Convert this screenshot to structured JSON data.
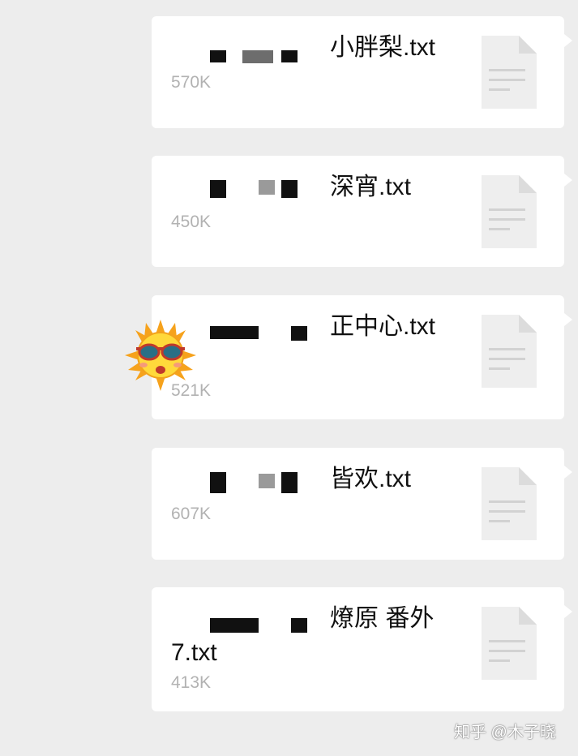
{
  "files": [
    {
      "name": "小胖梨.txt",
      "size": "570K"
    },
    {
      "name": "深宵.txt",
      "size": "450K"
    },
    {
      "name": "正中心.txt",
      "size": "521K"
    },
    {
      "name": "皆欢.txt",
      "size": "607K"
    },
    {
      "name": "燎原 番外7.txt",
      "size": "413K"
    }
  ],
  "watermark": "知乎 @木子晓",
  "icons": {
    "file": "document-icon",
    "sticker": "sun-sunglasses-sticker"
  },
  "colors": {
    "background": "#ededed",
    "bubble": "#ffffff",
    "size_text": "#b2b2b2",
    "doc_icon": "#eeeeee"
  }
}
